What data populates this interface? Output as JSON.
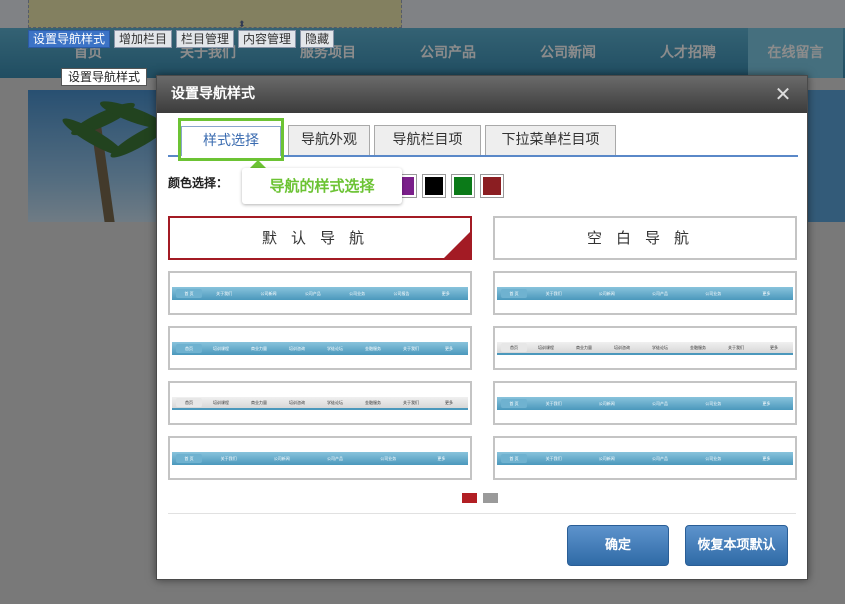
{
  "background": {
    "toolbar": [
      "设置导航样式",
      "增加栏目",
      "栏目管理",
      "内容管理",
      "隐藏"
    ],
    "tooltip": "设置导航样式",
    "nav_items": [
      "首页",
      "关于我们",
      "服务项目",
      "公司产品",
      "公司新闻",
      "人才招聘",
      "在线留言"
    ]
  },
  "dialog": {
    "title": "设置导航样式",
    "close_icon": "close-icon",
    "tabs": [
      {
        "label": "样式选择",
        "active": true
      },
      {
        "label": "导航外观",
        "active": false
      },
      {
        "label": "导航栏目项",
        "active": false
      },
      {
        "label": "下拉菜单栏目项",
        "active": false
      }
    ],
    "callout": "导航的样式选择",
    "color_label": "颜色选择：",
    "colors": [
      "#7a1f8a",
      "#000000",
      "#0b7a18",
      "#8b1e22"
    ],
    "styles": [
      {
        "label": "默认导航",
        "selected": true
      },
      {
        "label": "空白导航",
        "selected": false
      }
    ],
    "mini_items_a": [
      "首 页",
      "关于我们",
      "公司新闻",
      "公司产品",
      "公司业务",
      "公司报告",
      "更多"
    ],
    "mini_items_b": [
      "首页",
      "培训课程",
      "商业力量",
      "培训咨询",
      "学徒论坛",
      "金融服务",
      "关于我们",
      "更多"
    ],
    "pager": [
      1,
      2
    ],
    "buttons": {
      "ok": "确定",
      "reset": "恢复本项默认"
    },
    "accent_color": "#6cc334",
    "selected_color": "#a31b24"
  }
}
